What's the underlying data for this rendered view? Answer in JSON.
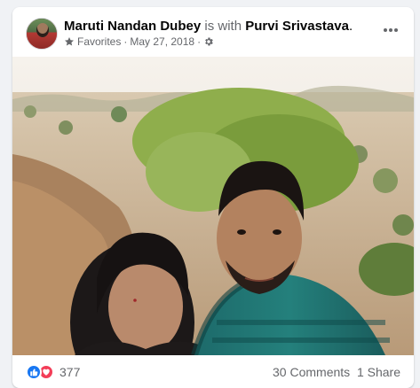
{
  "post": {
    "author": "Maruti Nandan Dubey",
    "connector": " is with ",
    "tagged": "Purvi Srivastava",
    "period": ".",
    "audience_label": "Favorites",
    "date": "May 27, 2018",
    "separator": " · ",
    "separator2": " ·",
    "reaction_count": "377",
    "comments": "30 Comments",
    "shares": "1 Share"
  },
  "icons": {
    "audience": "star-icon",
    "privacy": "gear-icon",
    "more": "more-options-icon",
    "like": "like-icon",
    "love": "love-icon"
  },
  "colors": {
    "link_blue": "#1877f2",
    "love_red": "#f33e58",
    "text_primary": "#050505",
    "text_secondary": "#65676b"
  }
}
